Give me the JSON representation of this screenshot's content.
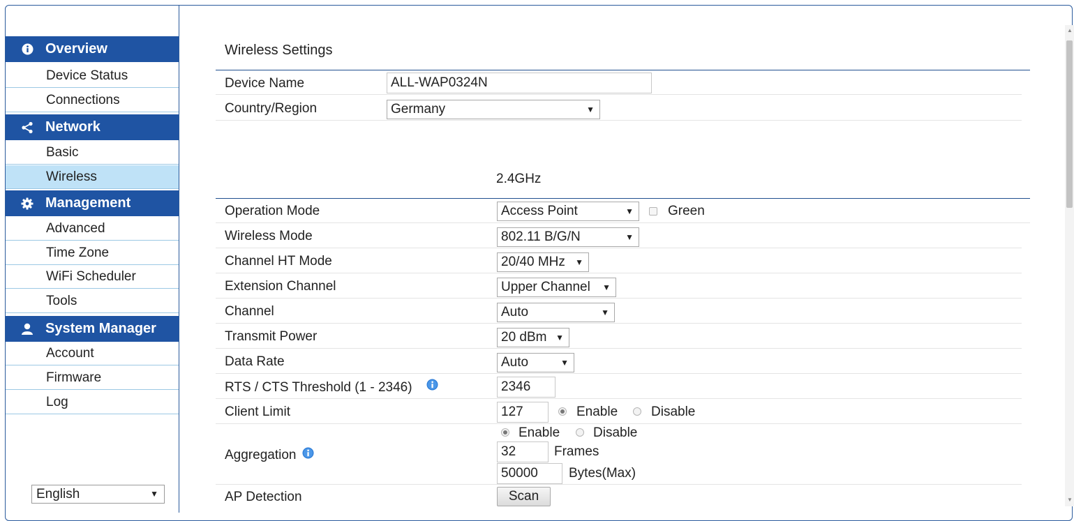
{
  "sidebar": {
    "sections": [
      {
        "title": "Overview",
        "icon": "info-icon",
        "items": [
          "Device Status",
          "Connections"
        ]
      },
      {
        "title": "Network",
        "icon": "share-icon",
        "items": [
          "Basic",
          "Wireless"
        ]
      },
      {
        "title": "Management",
        "icon": "gear-icon",
        "items": [
          "Advanced",
          "Time Zone",
          "WiFi Scheduler",
          "Tools"
        ]
      },
      {
        "title": "System Manager",
        "icon": "user-icon",
        "items": [
          "Account",
          "Firmware",
          "Log"
        ]
      }
    ],
    "active_item": "Wireless",
    "language": "English"
  },
  "main": {
    "title": "Wireless Settings",
    "device_name_label": "Device Name",
    "device_name_value": "ALL-WAP0324N",
    "country_label": "Country/Region",
    "country_value": "Germany",
    "band_heading": "2.4GHz",
    "operation_mode_label": "Operation Mode",
    "operation_mode_value": "Access Point",
    "green_label": "Green",
    "wireless_mode_label": "Wireless Mode",
    "wireless_mode_value": "802.11 B/G/N",
    "ht_mode_label": "Channel HT Mode",
    "ht_mode_value": "20/40 MHz",
    "ext_channel_label": "Extension Channel",
    "ext_channel_value": "Upper Channel",
    "channel_label": "Channel",
    "channel_value": "Auto",
    "tx_power_label": "Transmit Power",
    "tx_power_value": "20 dBm",
    "data_rate_label": "Data Rate",
    "data_rate_value": "Auto",
    "rts_label": "RTS / CTS Threshold (1 - 2346)",
    "rts_value": "2346",
    "client_limit_label": "Client Limit",
    "client_limit_value": "127",
    "enable_label": "Enable",
    "disable_label": "Disable",
    "aggregation_label": "Aggregation",
    "frames_value": "32",
    "frames_label": "Frames",
    "bytes_value": "50000",
    "bytes_label": "Bytes(Max)",
    "ap_detection_label": "AP Detection",
    "scan_label": "Scan"
  },
  "colors": {
    "section_header": "#1f54a3",
    "active_item": "#bfe2f7",
    "divider": "#1f4f8f"
  }
}
